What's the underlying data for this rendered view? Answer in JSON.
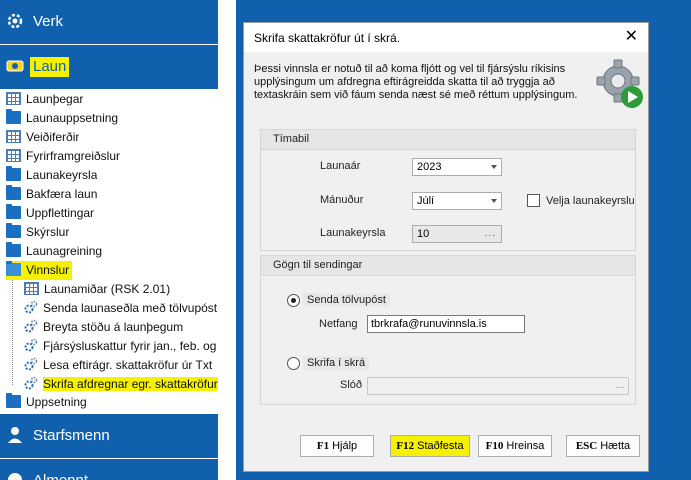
{
  "nav": {
    "sections": {
      "verk": "Verk",
      "laun": "Laun",
      "starfsmenn": "Starfsmenn",
      "almennt": "Almennt"
    },
    "items": [
      "Launþegar",
      "Launauppsetning",
      "Veiðiferðir",
      "Fyrirframgreiðslur",
      "Launakeyrsla",
      "Bakfæra laun",
      "Uppflettingar",
      "Skýrslur",
      "Launagreining",
      "Vinnslur",
      "Launamiðar (RSK 2.01)",
      "Senda launaseðla með tölvupóst",
      "Breyta stöðu á launþegum",
      "Fjársýsluskattur fyrir jan., feb. og mars",
      "Lesa eftirágr. skattakröfur úr Txt",
      "Skrifa afdregnar egr. skattakröfur",
      "Uppsetning"
    ]
  },
  "dialog": {
    "title": "Skrifa skattakröfur út í skrá.",
    "description": "Þessi vinnsla er notuð til að koma fljótt og vel til fjársýslu ríkisins upplýsingum um afdregna eftirágreidda skatta til að tryggja að textaskráin sem við fáum senda næst sé með réttum upplýsingum.",
    "timabil": {
      "header": "Tímabil",
      "launaar_label": "Launaár",
      "launaar_value": "2023",
      "manudur_label": "Mánuður",
      "manudur_value": "Júlí",
      "velja_label": "Velja launakeyrslu",
      "launakeyrsla_label": "Launakeyrsla",
      "launakeyrsla_value": "10",
      "dots": "..."
    },
    "gogn": {
      "header": "Gögn til sendingar",
      "senda_label": "Senda tölvupóst",
      "netfang_label": "Netfang",
      "netfang_value": "tbrkrafa@runuvinnsla.is",
      "skrifa_label": "Skrifa í skrá",
      "slod_label": "Slóð",
      "slod_value": "",
      "dots": "..."
    },
    "buttons": {
      "f1_key": "F1",
      "f1_label": "Hjálp",
      "f12_key": "F12",
      "f12_label": "Staðfesta",
      "f10_key": "F10",
      "f10_label": "Hreinsa",
      "esc_key": "ESC",
      "esc_label": "Hætta"
    }
  },
  "colors": {
    "nav_blue": "#1160ad",
    "highlight": "#f5f100",
    "dialog_bg": "#f0f0f0"
  }
}
